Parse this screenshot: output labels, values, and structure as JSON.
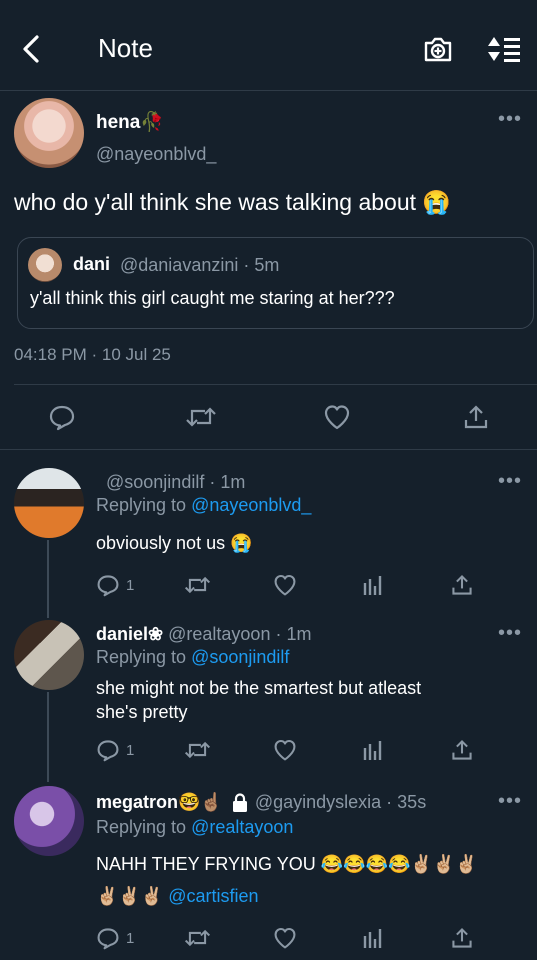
{
  "header": {
    "title": "Note"
  },
  "main_post": {
    "display_name": "hena🥀",
    "handle": "@nayeonblvd_",
    "text": "who do y'all think she was talking about 😭",
    "quote": {
      "display_name": "dani",
      "handle_time": "@daniavanzini · 5m",
      "text": "y'all think this girl caught me staring at her???"
    },
    "timestamp": "04:18 PM · 10 Jul 25"
  },
  "replies": [
    {
      "display_name": "",
      "handle_time": "@soonjindilf · 1m",
      "replying_label": "Replying to",
      "replying_to": "@nayeonblvd_",
      "text": "obviously not us 😭",
      "reply_count": "1"
    },
    {
      "display_name": "daniel❀",
      "handle_time": "@realtayoon · 1m",
      "replying_label": "Replying to",
      "replying_to": "@soonjindilf",
      "text_line1": "she might not be the smartest but atleast",
      "text_line2": "she's pretty",
      "reply_count": "1"
    },
    {
      "display_name": "megatron🤓☝🏽",
      "handle_time": "@gayindyslexia · 35s",
      "replying_label": "Replying to",
      "replying_to": "@realtayoon",
      "text_line1": "NAHH THEY FRYING YOU 😂😂😂😂✌🏼✌🏼✌🏼",
      "text_line2_prefix": "✌🏼✌🏼✌🏼",
      "mention": "@cartisfien",
      "reply_count": "1"
    }
  ],
  "colors": {
    "background": "#15202b",
    "accent": "#1d9bf0",
    "muted": "#8b98a5",
    "divider": "#2f3b47"
  }
}
